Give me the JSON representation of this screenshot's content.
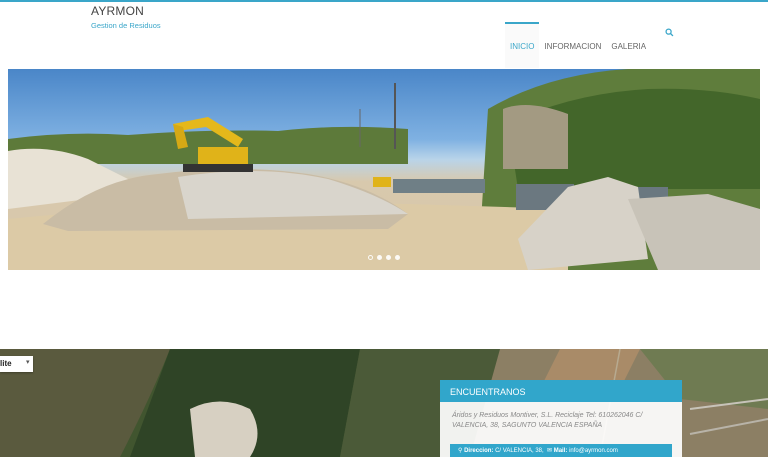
{
  "brand": {
    "title": "AYRMON",
    "subtitle": "Gestion de Residuos"
  },
  "nav": {
    "items": [
      {
        "label": "INICIO",
        "active": true
      },
      {
        "label": "INFORMACION",
        "active": false
      },
      {
        "label": "GALERIA",
        "active": false
      }
    ]
  },
  "icons": {
    "search": "search-icon"
  },
  "slider": {
    "slides": 4,
    "active_index": 0
  },
  "map": {
    "type_label": "lite",
    "caret": "▾"
  },
  "contact": {
    "heading": "ENCUENTRANOS",
    "description": "Áridos y Residuos Montiver, S.L. Reciclaje Tel: 610262046 C/ VALENCIA, 38, SAGUNTO VALENCIA ESPAÑA",
    "address_label": "Direccion:",
    "address_value": "C/ VALENCIA, 38,",
    "mail_label": "Mail:",
    "mail_value": "info@ayrmon.com"
  },
  "colors": {
    "accent": "#31a6cb",
    "text": "#666666"
  }
}
